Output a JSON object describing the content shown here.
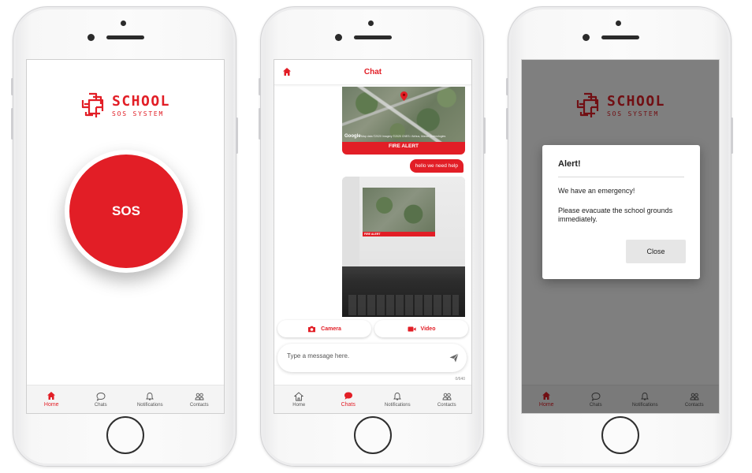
{
  "logo": {
    "title": "SCHOOL",
    "subtitle": "SOS SYSTEM"
  },
  "home": {
    "sos_label": "SOS"
  },
  "tabs": [
    {
      "label": "Home",
      "icon": "home-icon"
    },
    {
      "label": "Chats",
      "icon": "chat-bubble-icon"
    },
    {
      "label": "Notifications",
      "icon": "bell-icon"
    },
    {
      "label": "Contacts",
      "icon": "people-icon"
    }
  ],
  "chat": {
    "title": "Chat",
    "map_google": "Google",
    "map_attribution": "Map data ©2020 Imagery ©2020 CNES / Airbus, Maxar Technologies",
    "fire_alert": "FIRE ALERT",
    "message_text": "hello we need help",
    "photo_fire_alert": "FIRE ALERT",
    "camera_label": "Camera",
    "video_label": "Video",
    "input_placeholder": "Type a message here.",
    "char_count": "0/640"
  },
  "alert": {
    "title": "Alert!",
    "line1": "We have an emergency!",
    "line2": "Please evacuate the school grounds immediately.",
    "close_label": "Close"
  },
  "colors": {
    "brand_red": "#e21e26",
    "tab_bg": "#f4f4f4",
    "overlay": "rgba(0,0,0,0.5)"
  }
}
